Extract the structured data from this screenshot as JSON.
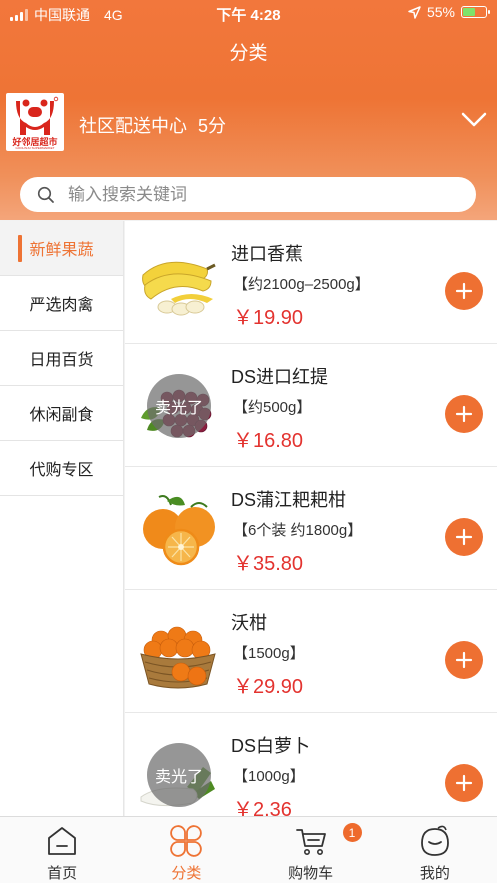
{
  "status_bar": {
    "carrier": "中国联通",
    "network": "4G",
    "time": "下午 4:28",
    "battery": "55%",
    "battery_level": 0.55
  },
  "header": {
    "title": "分类",
    "store_name": "社区配送中心",
    "store_rating": "5分",
    "logo_text": "好邻居超市",
    "logo_subtext": "GOOLINJU SUPERMARKET"
  },
  "search": {
    "placeholder": "输入搜索关键词",
    "value": ""
  },
  "categories": [
    {
      "label": "新鲜果蔬",
      "active": true
    },
    {
      "label": "严选肉禽",
      "active": false
    },
    {
      "label": "日用百货",
      "active": false
    },
    {
      "label": "休闲副食",
      "active": false
    },
    {
      "label": "代购专区",
      "active": false
    }
  ],
  "products": [
    {
      "name": "进口香蕉",
      "spec": "【约2100g–2500g】",
      "price": "￥19.90",
      "sold_out": false,
      "image": "banana-image"
    },
    {
      "name": "DS进口红提",
      "spec": "【约500g】",
      "price": "￥16.80",
      "sold_out": true,
      "sold_out_label": "卖光了",
      "image": "red-grape-image"
    },
    {
      "name": "DS蒲江耙耙柑",
      "spec": "【6个装 约1800g】",
      "price": "￥35.80",
      "sold_out": false,
      "image": "orange-image"
    },
    {
      "name": "沃柑",
      "spec": "【1500g】",
      "price": "￥29.90",
      "sold_out": false,
      "image": "tangerine-basket-image"
    },
    {
      "name": "DS白萝卜",
      "spec": "【1000g】",
      "price": "￥2.36",
      "sold_out": true,
      "sold_out_label": "卖光了",
      "image": "white-radish-image"
    }
  ],
  "tabbar": {
    "tabs": [
      {
        "label": "首页",
        "icon": "home-icon",
        "active": false
      },
      {
        "label": "分类",
        "icon": "category-icon",
        "active": true
      },
      {
        "label": "购物车",
        "icon": "cart-icon",
        "active": false,
        "badge": "1"
      },
      {
        "label": "我的",
        "icon": "profile-icon",
        "active": false
      }
    ]
  },
  "colors": {
    "accent": "#ee7334",
    "price": "#e3332f",
    "logo_red": "#d9261c"
  }
}
